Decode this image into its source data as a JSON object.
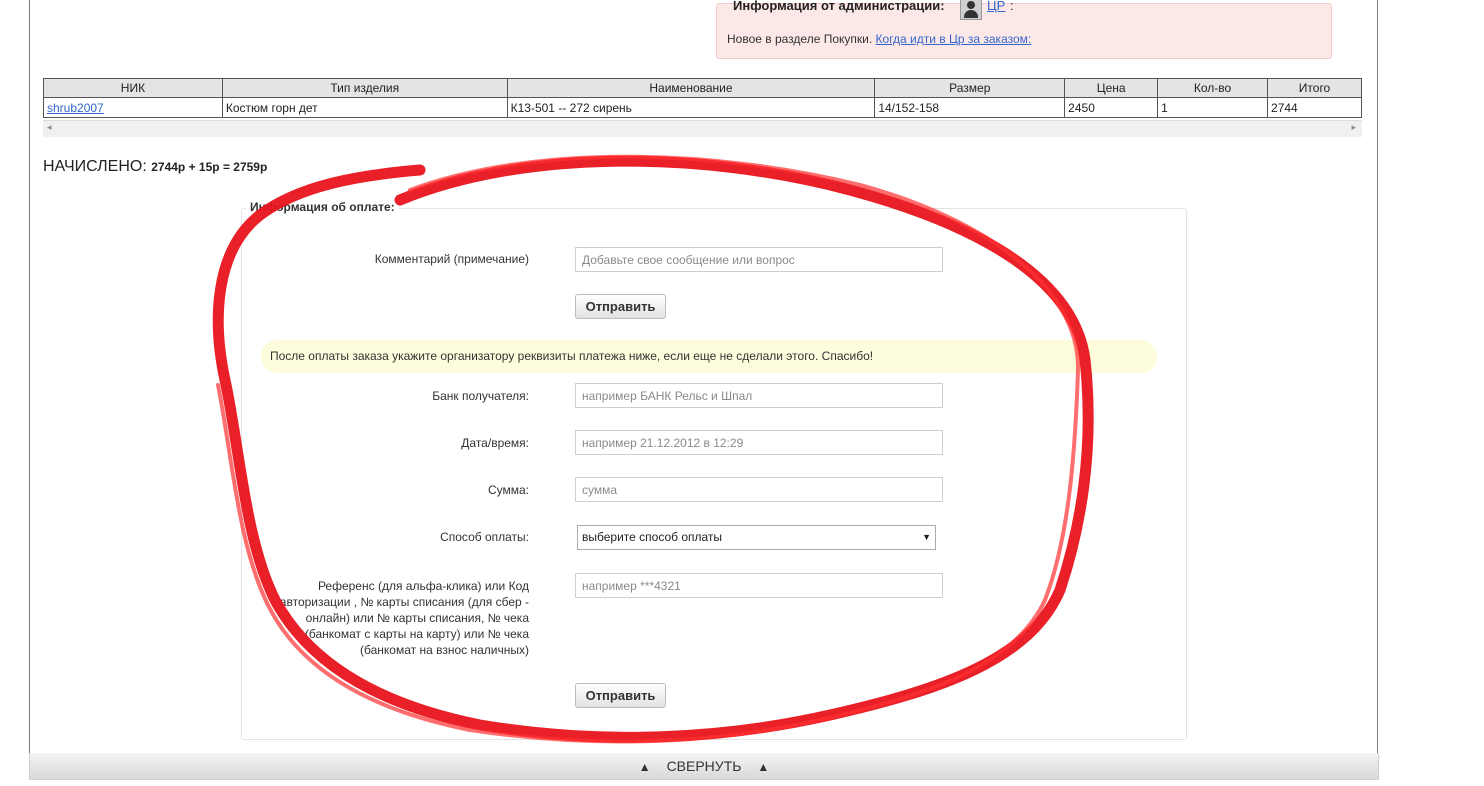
{
  "admin": {
    "title": "Информация от администрации:",
    "link": "ЦР",
    "colon": ":",
    "text": "Новое в разделе Покупки.",
    "text_link": "Когда идти в Цр за заказом:"
  },
  "table": {
    "headers": [
      "НИК",
      "Тип изделия",
      "Наименование",
      "Размер",
      "Цена",
      "Кол-во",
      "Итого"
    ],
    "row": [
      "shrub2007",
      "Костюм горн дет",
      "К13-501 -- 272 сирень",
      "14/152-158",
      "2450",
      "1",
      "2744"
    ]
  },
  "scroll": {
    "left_arrow": "◂",
    "right_arrow": "▸"
  },
  "total": {
    "label": "НАЧИСЛЕНО:",
    "value": "2744р + 15р = 2759р"
  },
  "payment": {
    "legend": "Информация об оплате:",
    "comment_label": "Комментарий (примечание)",
    "comment_placeholder": "Добавьте свое сообщение или вопрос",
    "send_label": "Отправить",
    "notice": "После оплаты заказа укажите организатору реквизиты платежа ниже, если еще не сделали этого. Спасибо!",
    "bank_label": "Банк получателя:",
    "bank_placeholder": "например БАНК Рельс и Шпал",
    "date_label": "Дата/время:",
    "date_placeholder": "например 21.12.2012 в 12:29",
    "sum_label": "Сумма:",
    "sum_placeholder": "сумма",
    "method_label": "Способ оплаты:",
    "method_selected": "выберите способ оплаты",
    "ref_label": "Референс (для альфа-клика) или Код авторизации , № карты списания (для сбер - онлайн) или № карты списания, № чека (банкомат с карты на карту) или № чека (банкомат на взнос наличных)",
    "ref_placeholder": "например ***4321",
    "send2_label": "Отправить"
  },
  "footer": {
    "collapse_label": "СВЕРНУТЬ",
    "arrow": "▲"
  }
}
